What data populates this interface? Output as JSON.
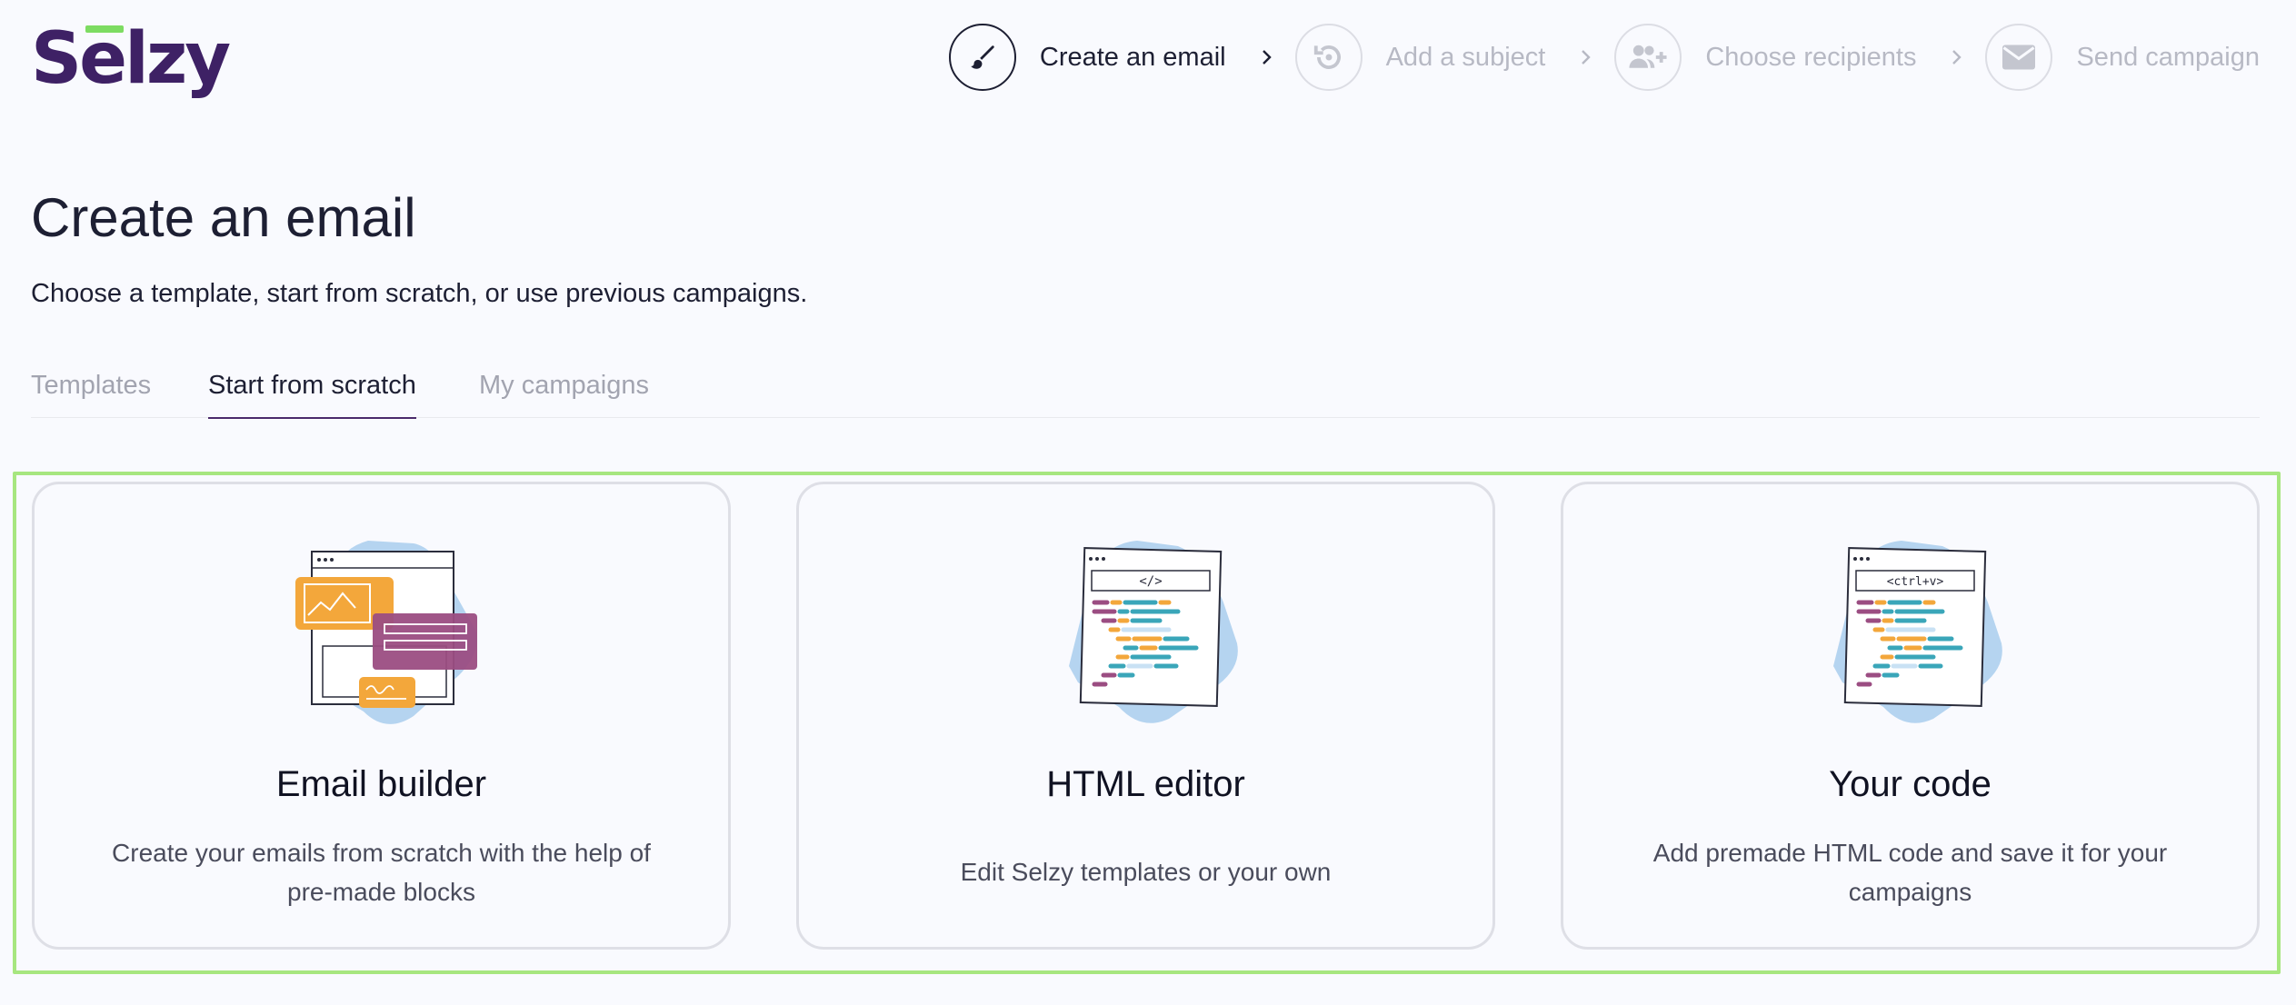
{
  "logo": {
    "text": "Selzy",
    "accent_color": "#7ddc62",
    "brand_color": "#3e2165"
  },
  "steps": [
    {
      "label": "Create an email",
      "icon": "brush-icon",
      "active": true
    },
    {
      "label": "Add a subject",
      "icon": "history-icon",
      "active": false
    },
    {
      "label": "Choose recipients",
      "icon": "add-user-icon",
      "active": false
    },
    {
      "label": "Send campaign",
      "icon": "envelope-icon",
      "active": false
    }
  ],
  "page": {
    "title": "Create an email",
    "subtitle": "Choose a template, start from scratch, or use previous campaigns."
  },
  "tabs": [
    {
      "label": "Templates",
      "active": false
    },
    {
      "label": "Start from scratch",
      "active": true
    },
    {
      "label": "My campaigns",
      "active": false
    }
  ],
  "cards": [
    {
      "title": "Email builder",
      "description": "Create your emails from scratch with the help of pre-made blocks",
      "icon": "email-builder-illustration"
    },
    {
      "title": "HTML editor",
      "description": "Edit Selzy templates or your own",
      "icon": "html-editor-illustration",
      "code_tag": "</>"
    },
    {
      "title": "Your code",
      "description": "Add premade HTML code and save it for your campaigns",
      "icon": "your-code-illustration",
      "code_tag": "<ctrl+v>"
    }
  ],
  "colors": {
    "highlight_border": "#a7e67f",
    "illustration_blob": "#b5d4f0",
    "code_teal": "#3aa6b9",
    "code_orange": "#f3a73b",
    "code_purple": "#9b4d82"
  }
}
